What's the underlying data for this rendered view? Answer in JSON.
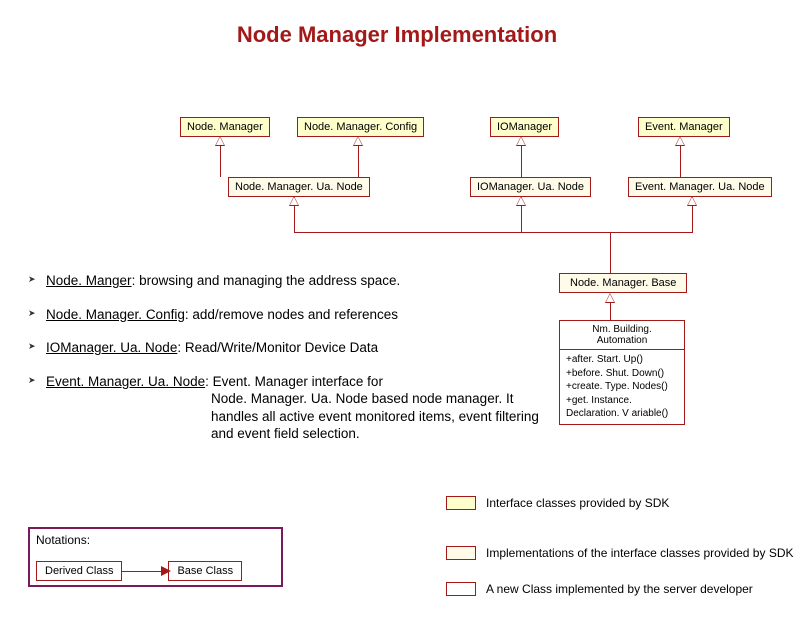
{
  "title": "Node Manager Implementation",
  "boxes": {
    "nodeManager": "Node. Manager",
    "nodeManagerConfig": "Node. Manager. Config",
    "ioManager": "IOManager",
    "eventManager": "Event. Manager",
    "nodeManagerUaNode": "Node. Manager. Ua. Node",
    "ioManagerUaNode": "IOManager. Ua. Node",
    "eventManagerUaNode": "Event. Manager. Ua. Node",
    "nodeManagerBase": "Node. Manager. Base"
  },
  "bullets": [
    {
      "label": "Node. Manger",
      "desc": ": browsing and managing the address space."
    },
    {
      "label": "Node. Manager. Config",
      "desc": ": add/remove nodes and references"
    },
    {
      "label": "IOManager. Ua. Node",
      "desc": ": Read/Write/Monitor Device Data"
    },
    {
      "label": "Event. Manager. Ua. Node",
      "desc": ": Event. Manager interface for",
      "extended": "Node. Manager. Ua. Node based node manager. It handles all active event monitored items, event filtering and event field selection."
    }
  ],
  "classBox": {
    "name": "Nm. Building. Automation",
    "methods": [
      "+after. Start. Up()",
      "+before. Shut. Down()",
      "+create. Type. Nodes()",
      "+get. Instance. Declaration. V ariable()"
    ]
  },
  "legend": {
    "l1": "Interface classes provided by SDK",
    "l2": "Implementations of the interface classes provided by SDK",
    "l3": "A new Class implemented by the server developer"
  },
  "notations": {
    "title": "Notations:",
    "derived": "Derived Class",
    "base": "Base Class"
  }
}
